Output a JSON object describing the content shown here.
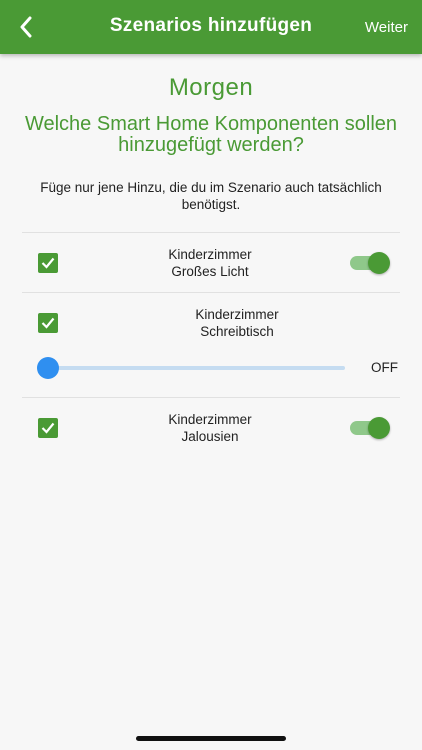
{
  "appbar": {
    "title": "Szenarios hinzufügen",
    "action_label": "Weiter",
    "back_icon": "chevron-left-icon"
  },
  "scenario": {
    "name": "Morgen",
    "question": "Welche Smart Home Komponenten sollen hinzugefügt werden?",
    "hint": "Füge nur jene Hinzu, die du im Szenario auch tatsächlich benötigst."
  },
  "components": [
    {
      "room": "Kinderzimmer",
      "device": "Großes Licht",
      "selected": true,
      "control": "toggle",
      "on": true
    },
    {
      "room": "Kinderzimmer",
      "device": "Schreibtisch",
      "selected": true,
      "control": "slider",
      "level": 0,
      "level_label": "OFF"
    },
    {
      "room": "Kinderzimmer",
      "device": "Jalousien",
      "selected": true,
      "control": "toggle",
      "on": true
    }
  ],
  "colors": {
    "primary": "#4a9a35",
    "slider": "#2f8ff0",
    "background": "#f7f7f7"
  }
}
